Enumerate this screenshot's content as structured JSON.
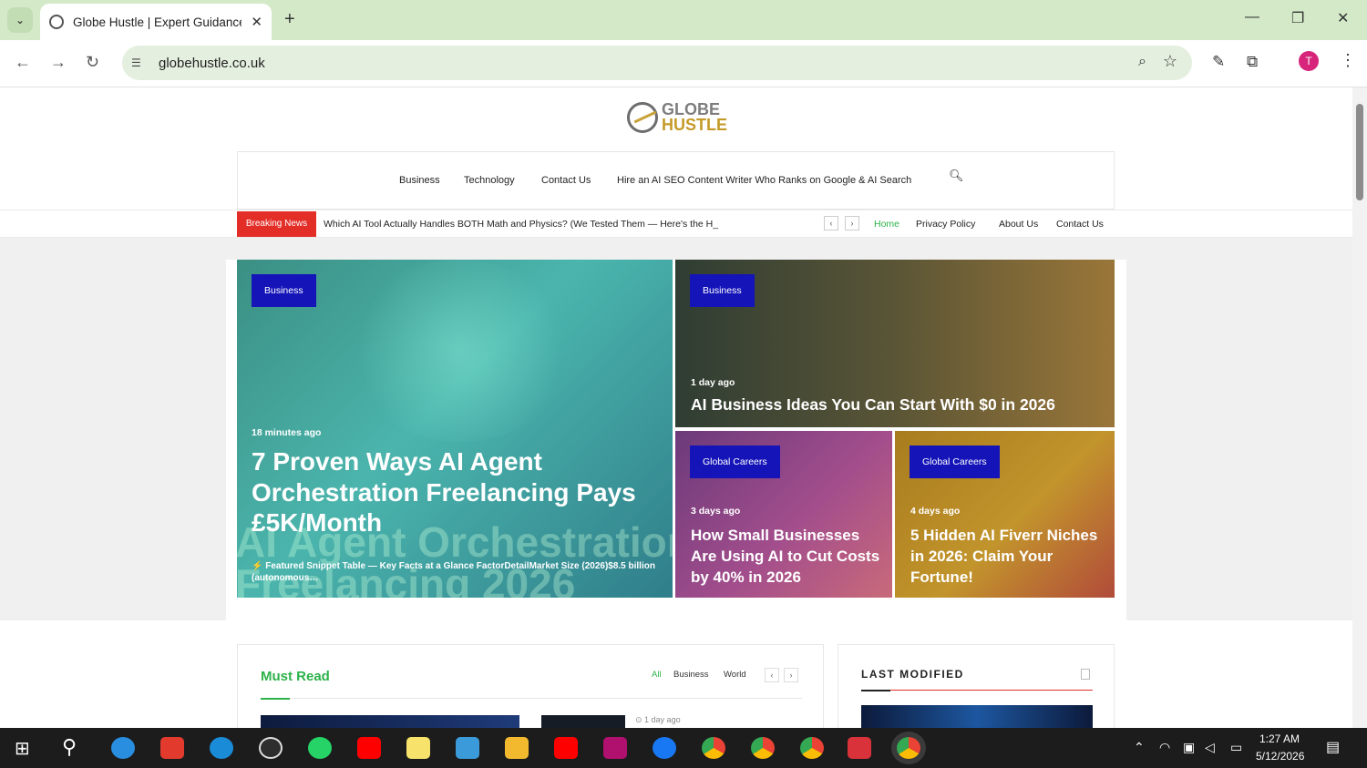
{
  "browser": {
    "tab_title": "Globe Hustle | Expert Guidance",
    "tab_close": "✕",
    "new_tab": "+",
    "url": "globehustle.co.uk",
    "window_controls": {
      "minimize": "—",
      "restore": "❐",
      "close": "✕"
    },
    "avatar_letter": "T"
  },
  "site": {
    "logo_line1": "GLOBE",
    "logo_line2": "HUSTLE",
    "nav": [
      "Business",
      "Technology",
      "Contact Us",
      "Hire an AI SEO Content Writer Who Ranks on Google & AI Search"
    ],
    "breaking_label": "Breaking News",
    "breaking_text": "Which AI Tool Actually Handles BOTH Math and Physics? (We Tested Them — Here's the H_",
    "top_links": [
      "Home",
      "Privacy Policy",
      "About Us",
      "Contact Us"
    ]
  },
  "hero": [
    {
      "badge": "Business",
      "time": "18 minutes ago",
      "title": "7 Proven Ways AI Agent Orchestration Freelancing Pays £5K/Month",
      "excerpt": "⚡ Featured Snippet Table — Key Facts at a Glance FactorDetailMarket Size (2026)$8.5 billion (autonomous…",
      "ghost": "AI Agent Orchestration Freelancing 2026"
    },
    {
      "badge": "Business",
      "time": "1 day ago",
      "title": "AI Business Ideas You Can Start With $0 in 2026"
    },
    {
      "badge": "Global Careers",
      "time": "3 days ago",
      "title": "How Small Businesses Are Using AI to Cut Costs by 40% in 2026"
    },
    {
      "badge": "Global Careers",
      "time": "4 days ago",
      "title": "5 Hidden AI Fiverr Niches in 2026: Claim Your Fortune!"
    }
  ],
  "must_read": {
    "title": "Must Read",
    "filters": [
      "All",
      "Business",
      "World"
    ],
    "meta": "⊙ 1 day ago"
  },
  "last_modified": {
    "title": "LAST MODIFIED"
  },
  "taskbar": {
    "time": "1:27 AM",
    "date": "5/12/2026"
  },
  "colors": {
    "accent_green": "#2db24a",
    "badge_blue": "#1414b8",
    "breaking_red": "#e32d27",
    "chrome_green": "#d3e9c7"
  }
}
